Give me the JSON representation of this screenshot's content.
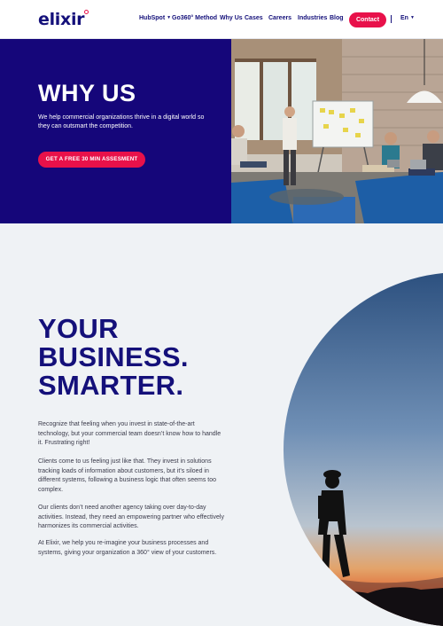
{
  "header": {
    "logo": "elixir",
    "nav": [
      "HubSpot",
      "Go360° Method",
      "Why Us",
      "Cases",
      "Careers",
      "Industries",
      "Blog"
    ],
    "contact_label": "Contact",
    "lang": "En"
  },
  "hero": {
    "title": "WHY US",
    "subtitle": "We help commercial organizations thrive in a digital world so they can outsmart the competition.",
    "cta": "GET A FREE 30 MIN ASSESMENT"
  },
  "section": {
    "title_lines": [
      "YOUR",
      "BUSINESS.",
      "SMARTER."
    ],
    "paragraphs": [
      "Recognize that feeling when you invest in state-of-the-art technology, but your commercial team doesn’t know how to handle it. Frustrating right!",
      "Clients come to us feeling just like that. They invest in solutions tracking loads of information about  customers, but it’s siloed in different systems, following a business logic that often seems too complex.",
      "Our clients don’t need another agency taking over day-to-day activities. Instead, they need an empowering partner who effectively harmonizes its commercial activities.",
      "At Elixir, we help you re-imagine your business processes and systems, giving your organization a 360° view of your customers."
    ]
  },
  "colors": {
    "brand": "#14107a",
    "accent": "#e8114a",
    "hero_bg": "#15067a",
    "section_bg": "#eff2f5"
  }
}
